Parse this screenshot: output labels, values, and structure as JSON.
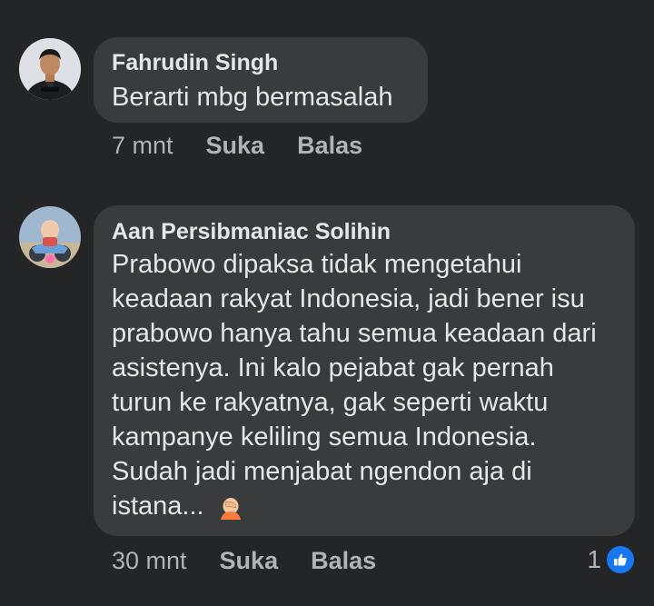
{
  "comments": [
    {
      "author": "Fahrudin Singh",
      "text": "Berarti mbg bermasalah",
      "time": "7 mnt",
      "like_label": "Suka",
      "reply_label": "Balas",
      "avatar_icon": "profile-photo-man-dark-jacket"
    },
    {
      "author": "Aan Persibmaniac Solihin",
      "text": "Prabowo dipaksa tidak mengetahui keadaan rakyat Indonesia, jadi bener isu prabowo hanya tahu semua keadaan dari asistenya. Ini kalo pejabat gak pernah turun ke rakyatnya, gak seperti waktu kampanye keliling semua Indonesia. Sudah jadi menjabat ngendon aja di istana...",
      "emoji": "face-palm-emoji",
      "time": "30 mnt",
      "like_label": "Suka",
      "reply_label": "Balas",
      "reaction_count": "1",
      "reaction_icon": "like-thumb-icon",
      "avatar_icon": "profile-photo-cartoon-motorbike"
    }
  ],
  "colors": {
    "background": "#242526",
    "bubble": "#3a3b3c",
    "text_primary": "#e4e6eb",
    "text_secondary": "#b0b3b8",
    "like_blue": "#1877f2"
  }
}
